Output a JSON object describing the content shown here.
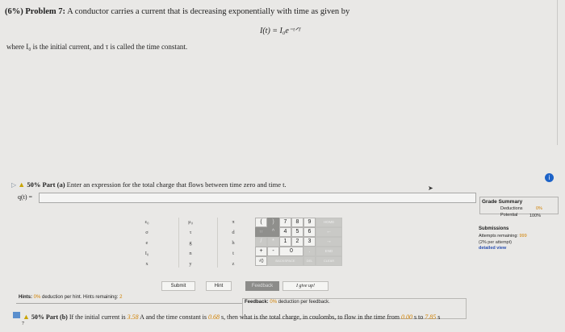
{
  "problem": {
    "weight": "(6%)",
    "number": "Problem 7:",
    "statement": "A conductor carries a current that is decreasing exponentially with time as given by",
    "formula": "I(t) = I₀e⁻ᵗᐟᵀ",
    "where_text": "where I₀ is the initial current, and τ is called the time constant."
  },
  "part_a": {
    "percent": "50%",
    "label": "Part (a)",
    "prompt": "Enter an expression for the total charge that flows between time zero and time t.",
    "input_label": "q(t) =",
    "input_value": ""
  },
  "grade_summary": {
    "title": "Grade Summary",
    "deductions_label": "Deductions",
    "deductions_value": "0%",
    "potential_label": "Potential",
    "potential_value": "100%"
  },
  "submissions": {
    "title": "Submissions",
    "attempts_label": "Attempts remaining:",
    "attempts_value": "999",
    "per_attempt": "(2% per attempt)",
    "detailed_view": "detailed view"
  },
  "symbol_keys": {
    "col1": [
      "ε₀",
      "σ",
      "e",
      "I₀",
      "x"
    ],
    "col2": [
      "μ₀",
      "τ",
      "g",
      "n",
      "y"
    ],
    "col3": [
      "π",
      "d",
      "h",
      "t",
      "z"
    ]
  },
  "number_keys": {
    "row1": [
      "(",
      ")",
      "7",
      "8",
      "9",
      "HOME"
    ],
    "row2": [
      "↑↑",
      "^",
      "4",
      "5",
      "6",
      "←"
    ],
    "row3": [
      "/",
      "*",
      "1",
      "2",
      "3",
      "→"
    ],
    "row4": [
      "+",
      "-",
      "0",
      ".",
      "END"
    ],
    "row5": [
      "√()",
      "BACKSPACE",
      "DEL",
      "CLEAR"
    ]
  },
  "actions": {
    "submit": "Submit",
    "hint": "Hint",
    "feedback": "Feedback",
    "give_up": "I give up!"
  },
  "hints": {
    "label": "Hints:",
    "deduction": "0%",
    "deduction_text": "deduction per hint. Hints remaining:",
    "remaining": "2"
  },
  "feedback": {
    "label": "Feedback:",
    "deduction": "0%",
    "text": "deduction per feedback."
  },
  "part_b": {
    "percent": "50%",
    "label": "Part (b)",
    "text_1": "If the initial current is",
    "current": "3.58",
    "text_2": "A and the time constant is",
    "tau": "0.68",
    "text_3": "s, then what is the total charge, in coulombs, to flow in the time from",
    "t0": "0.00",
    "text_4": "s to",
    "t1": "7.85",
    "text_5": "s"
  },
  "misc": {
    "seven": "7"
  }
}
